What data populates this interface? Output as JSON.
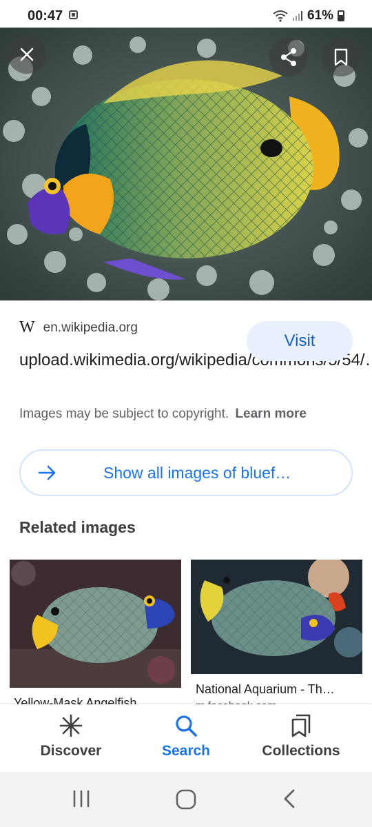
{
  "status_bar": {
    "time": "00:47",
    "battery": "61%"
  },
  "hero": {
    "close_icon": "close-icon",
    "share_icon": "share-icon",
    "bookmark_icon": "bookmark-icon"
  },
  "result": {
    "site_logo": "W",
    "domain": "en.wikipedia.org",
    "title": "upload.wikimedia.org/wikipedia/commons/5/54/…",
    "visit_label": "Visit",
    "copyright_text": "Images may be subject to copyright.",
    "learn_more": "Learn more",
    "show_all_label": "Show all images of bluef…"
  },
  "related": {
    "heading": "Related images",
    "items": [
      {
        "caption": "Yellow-Mask Angelfish",
        "source": ""
      },
      {
        "caption": "National Aquarium - Th…",
        "source": "m.facebook.com"
      }
    ]
  },
  "bottom_nav": {
    "items": [
      {
        "label": "Discover",
        "icon": "asterisk-icon",
        "active": false
      },
      {
        "label": "Search",
        "icon": "search-icon",
        "active": true
      },
      {
        "label": "Collections",
        "icon": "collections-icon",
        "active": false
      }
    ]
  },
  "colors": {
    "accent": "#1a73e8",
    "visit_bg": "#e8f0fe"
  }
}
